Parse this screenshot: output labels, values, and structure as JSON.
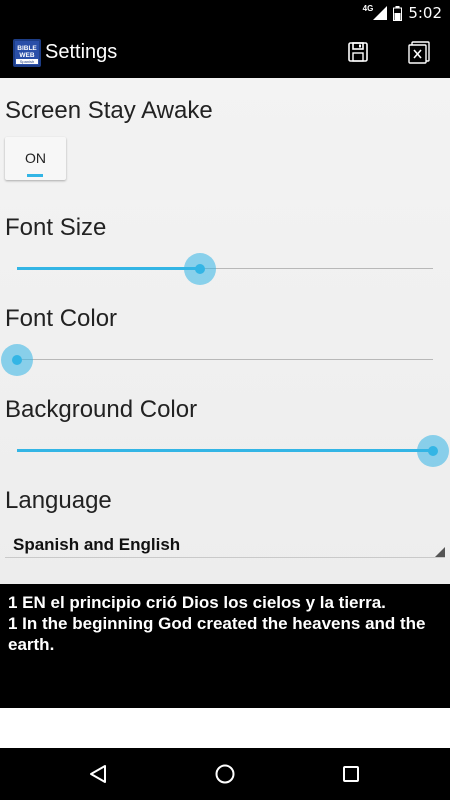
{
  "status_bar": {
    "network_type": "4G",
    "time": "5:02"
  },
  "action_bar": {
    "app_icon_text_top": "BIBLE WEB",
    "app_icon_text_bottom": "Spanish",
    "title": "Settings",
    "icons": {
      "save": "save-icon",
      "close": "close-icon"
    }
  },
  "settings": {
    "screen_stay_awake": {
      "label": "Screen Stay Awake",
      "toggle_text": "ON"
    },
    "font_size": {
      "label": "Font Size",
      "value": 0.44
    },
    "font_color": {
      "label": "Font Color",
      "value": 0.0
    },
    "background_color": {
      "label": "Background Color",
      "value": 1.0
    },
    "language": {
      "label": "Language",
      "selected": "Spanish and English"
    }
  },
  "preview": {
    "line1": "1 EN el principio crió Dios los cielos y la tierra.",
    "line2": "1 In the beginning God created the heavens and the earth."
  },
  "nav_bar": {
    "icons": [
      "back-icon",
      "home-icon",
      "recents-icon"
    ]
  },
  "colors": {
    "accent": "#33b5e5",
    "bar_background": "#000000",
    "content_background": "#f0f0f0"
  }
}
